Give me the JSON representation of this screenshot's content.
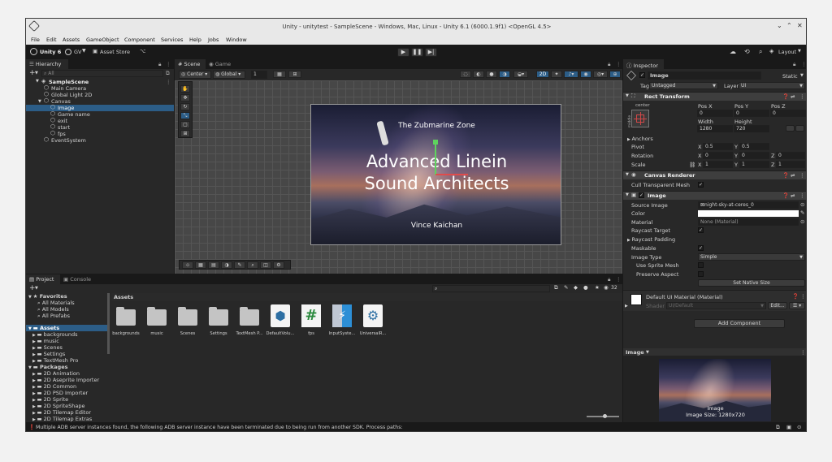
{
  "window": {
    "title": "Unity - unitytest - SampleScene - Windows, Mac, Linux - Unity 6.1 (6000.1.9f1) <OpenGL 4.5>"
  },
  "menu": [
    "File",
    "Edit",
    "Assets",
    "GameObject",
    "Component",
    "Services",
    "Help",
    "Jobs",
    "Window"
  ],
  "toolbar": {
    "unity_label": "Unity 6",
    "account": "GV",
    "asset_store": "Asset Store",
    "layout": "Layout"
  },
  "hierarchy": {
    "tab": "Hierarchy",
    "search_placeholder": "All",
    "scene": "SampleScene",
    "items": [
      {
        "label": "Main Camera",
        "indent": 1
      },
      {
        "label": "Global Light 2D",
        "indent": 1
      },
      {
        "label": "Canvas",
        "indent": 1
      },
      {
        "label": "Image",
        "indent": 2,
        "selected": true
      },
      {
        "label": "Game name",
        "indent": 2
      },
      {
        "label": "exit",
        "indent": 2
      },
      {
        "label": "start",
        "indent": 2
      },
      {
        "label": "fps",
        "indent": 2
      },
      {
        "label": "EventSystem",
        "indent": 1
      }
    ]
  },
  "scene_view": {
    "tab_scene": "Scene",
    "tab_game": "Game",
    "pivot": "Center",
    "space": "Global",
    "snap": "1",
    "mode": "2D",
    "canvas": {
      "subtitle": "The Zubmarine Zone",
      "title_line1": "Advanced Linein",
      "title_line2": "Sound Architects",
      "author": "Vince Kaichan"
    }
  },
  "project": {
    "tab_project": "Project",
    "tab_console": "Console",
    "hidden_count": "32",
    "favorites": {
      "label": "Favorites",
      "items": [
        "All Materials",
        "All Models",
        "All Prefabs"
      ]
    },
    "assets": {
      "label": "Assets",
      "items": [
        "backgrounds",
        "music",
        "Scenes",
        "Settings",
        "TextMesh Pro"
      ]
    },
    "packages": {
      "label": "Packages",
      "items": [
        "2D Animation",
        "2D Aseprite Importer",
        "2D Common",
        "2D PSD Importer",
        "2D Sprite",
        "2D SpriteShape",
        "2D Tilemap Editor",
        "2D Tilemap Extras"
      ]
    },
    "breadcrumb": "Assets",
    "grid": [
      {
        "label": "backgrounds",
        "kind": "folder"
      },
      {
        "label": "music",
        "kind": "folder"
      },
      {
        "label": "Scenes",
        "kind": "folder"
      },
      {
        "label": "Settings",
        "kind": "folder"
      },
      {
        "label": "TextMesh P...",
        "kind": "folder"
      },
      {
        "label": "DefaultVolu...",
        "kind": "cube"
      },
      {
        "label": "fps",
        "kind": "script"
      },
      {
        "label": "InputSyste...",
        "kind": "input"
      },
      {
        "label": "UniversalR...",
        "kind": "gear"
      }
    ]
  },
  "status": {
    "message": "Multiple ADB server instances found, the following ADB server instance have been terminated due to being run from another SDK. Process paths:"
  },
  "inspector": {
    "tab": "Inspector",
    "object_name": "Image",
    "static_label": "Static",
    "tag_label": "Tag",
    "tag": "Untagged",
    "layer_label": "Layer",
    "layer": "UI",
    "rect_transform": {
      "title": "Rect Transform",
      "anchor_preset": "center",
      "labels": {
        "posx": "Pos X",
        "posy": "Pos Y",
        "posz": "Pos Z",
        "width": "Width",
        "height": "Height"
      },
      "posx": "0",
      "posy": "0",
      "posz": "0",
      "width": "1280",
      "height": "720",
      "anchors": "Anchors",
      "pivot": "Pivot",
      "pivot_x": "0.5",
      "pivot_y": "0.5",
      "rotation": "Rotation",
      "rot_x": "0",
      "rot_y": "0",
      "rot_z": "0",
      "scale": "Scale",
      "scale_x": "1",
      "scale_y": "1",
      "scale_z": "1"
    },
    "canvas_renderer": {
      "title": "Canvas Renderer",
      "cull_label": "Cull Transparent Mesh"
    },
    "image": {
      "title": "Image",
      "source_label": "Source Image",
      "source": "night-sky-at-ceres_0",
      "color_label": "Color",
      "material_label": "Material",
      "material": "None (Material)",
      "raycast_target": "Raycast Target",
      "raycast_padding": "Raycast Padding",
      "maskable": "Maskable",
      "image_type_label": "Image Type",
      "image_type": "Simple",
      "use_sprite_mesh": "Use Sprite Mesh",
      "preserve_aspect": "Preserve Aspect",
      "set_native": "Set Native Size"
    },
    "material": {
      "name": "Default UI Material (Material)",
      "shader_label": "Shader",
      "shader": "UI/Default",
      "edit": "Edit..."
    },
    "add_component": "Add Component",
    "preview": {
      "header": "Image",
      "name": "Image",
      "size": "Image Size: 1280x720"
    }
  },
  "colors": {
    "accent": "#2c5d87",
    "selected": "#2c5d87",
    "bg": "#282828"
  }
}
